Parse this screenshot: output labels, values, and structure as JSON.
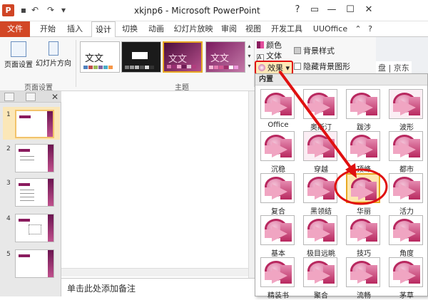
{
  "window": {
    "title": "xkjnp6 - Microsoft PowerPoint",
    "app_icon": "P",
    "controls": {
      "help": "?",
      "restore": "▭",
      "minimize": "—",
      "maximize": "☐",
      "close": "✕"
    }
  },
  "quick_access": {
    "save": "💾",
    "undo": "↶",
    "redo": "↷",
    "customize": "▾"
  },
  "tabs": [
    "文件",
    "开始",
    "插入",
    "设计",
    "切换",
    "动画",
    "幻灯片放映",
    "审阅",
    "视图",
    "开发工具",
    "UUOffice"
  ],
  "active_tab": "设计",
  "ribbon": {
    "page_setup_group": {
      "label": "页面设置",
      "page_setup": "页面设置",
      "orientation": "幻灯片方向"
    },
    "themes_group": {
      "label": "主题",
      "theme_text": "文文"
    },
    "colors_label": "颜色",
    "fonts_label": "文体",
    "effects_label": "效果",
    "background_styles_label": "背景样式",
    "hide_background_label": "隐藏背景图形",
    "right_fragment": "盘 | 京东"
  },
  "slides_panel": {
    "numbers": [
      "1",
      "2",
      "3",
      "4",
      "5"
    ],
    "selected": 1
  },
  "notes_placeholder": "单击此处添加备注",
  "effects_gallery": {
    "header": "内置",
    "items": [
      "Office",
      "奥斯汀",
      "跋涉",
      "波形",
      "沉稳",
      "穿越",
      "顶峰",
      "都市",
      "复合",
      "黑领结",
      "华丽",
      "活力",
      "基本",
      "极目远眺",
      "技巧",
      "角度",
      "精装书",
      "聚合",
      "流畅",
      "茅草"
    ],
    "selected": "华丽"
  },
  "colors": {
    "file_tab": "#d24726",
    "accent_magenta": "#b8285f",
    "annotation_red": "#e01010"
  }
}
